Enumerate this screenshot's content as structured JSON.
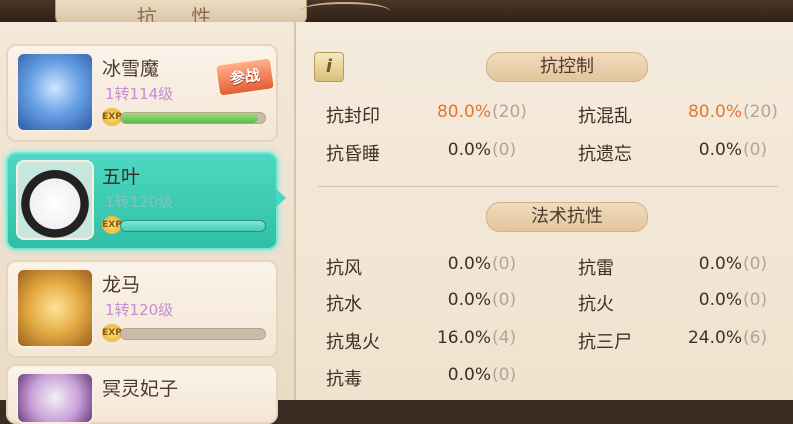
{
  "header": {
    "title": "抗 性"
  },
  "pets": [
    {
      "name": "冰雪魔",
      "level": "1转114级",
      "exp_fraction": 0.95,
      "badge": "参战",
      "selected": false
    },
    {
      "name": "五叶",
      "level": "1转120级",
      "exp_fraction": 1.0,
      "selected": true
    },
    {
      "name": "龙马",
      "level": "1转120级",
      "exp_fraction": 0.0,
      "selected": false
    },
    {
      "name": "冥灵妃子",
      "selected": false
    }
  ],
  "exp_label": "EXP",
  "info_button": "i",
  "sections": [
    {
      "title": "抗控制",
      "stats": [
        {
          "name": "抗封印",
          "value": "80.0%",
          "extra": "(20)",
          "highlight": true
        },
        {
          "name": "抗混乱",
          "value": "80.0%",
          "extra": "(20)",
          "highlight": true
        },
        {
          "name": "抗昏睡",
          "value": "0.0%",
          "extra": "(0)",
          "highlight": false
        },
        {
          "name": "抗遗忘",
          "value": "0.0%",
          "extra": "(0)",
          "highlight": false
        }
      ]
    },
    {
      "title": "法术抗性",
      "stats": [
        {
          "name": "抗风",
          "value": "0.0%",
          "extra": "(0)"
        },
        {
          "name": "抗雷",
          "value": "0.0%",
          "extra": "(0)"
        },
        {
          "name": "抗水",
          "value": "0.0%",
          "extra": "(0)"
        },
        {
          "name": "抗火",
          "value": "0.0%",
          "extra": "(0)"
        },
        {
          "name": "抗鬼火",
          "value": "16.0%",
          "extra": "(4)"
        },
        {
          "name": "抗三尸",
          "value": "24.0%",
          "extra": "(6)"
        },
        {
          "name": "抗毒",
          "value": "0.0%",
          "extra": "(0)"
        }
      ]
    }
  ],
  "colors": {
    "selected": "#3cc9b1",
    "highlight_value": "#e07a2e",
    "paren": "#b3a596"
  }
}
